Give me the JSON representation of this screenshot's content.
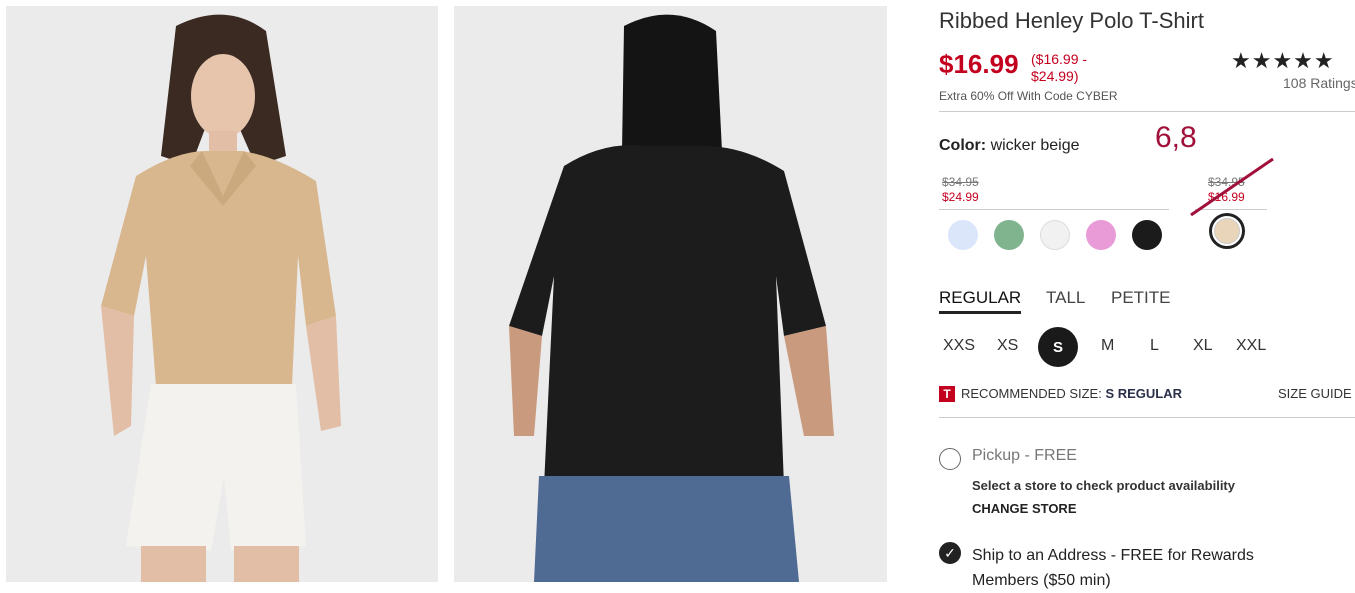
{
  "product": {
    "title": "Ribbed Henley Polo T-Shirt",
    "price": "$16.99",
    "price_range_line1": "($16.99 -",
    "price_range_line2": "$24.99)",
    "promo": "Extra 60% Off With Code CYBER",
    "stars": "★★★★★",
    "ratings": "108 Ratings"
  },
  "color": {
    "label": "Color:",
    "value": "wicker beige",
    "annotation": "6,8",
    "groups": [
      {
        "was": "$34.95",
        "now": "$24.99"
      },
      {
        "was": "$34.95",
        "now": "$16.99"
      }
    ],
    "swatches": [
      {
        "name": "light blue",
        "hex": "#dbe6fb"
      },
      {
        "name": "green",
        "hex": "#7fb48f"
      },
      {
        "name": "white",
        "hex": "#f1f1f1"
      },
      {
        "name": "pink",
        "hex": "#e89bd6"
      },
      {
        "name": "black",
        "hex": "#1b1b1b"
      },
      {
        "name": "wicker beige",
        "hex": "#e9d6ba"
      }
    ]
  },
  "fit_tabs": [
    "REGULAR",
    "TALL",
    "PETITE"
  ],
  "sizes": [
    "XXS",
    "XS",
    "S",
    "M",
    "L",
    "XL",
    "XXL"
  ],
  "selected_size": "S",
  "recommended": {
    "badge": "T",
    "label": "RECOMMENDED SIZE:",
    "value": "S REGULAR",
    "size_guide": "SIZE GUIDE"
  },
  "fulfillment": {
    "pickup_label": "Pickup - FREE",
    "store_note": "Select a store to check product availability",
    "change_store": "CHANGE STORE",
    "ship_label": "Ship to an Address - FREE for Rewards Members ($50 min)"
  },
  "colors": {
    "sale_red": "#c4001f",
    "annotation": "#a0103a"
  }
}
